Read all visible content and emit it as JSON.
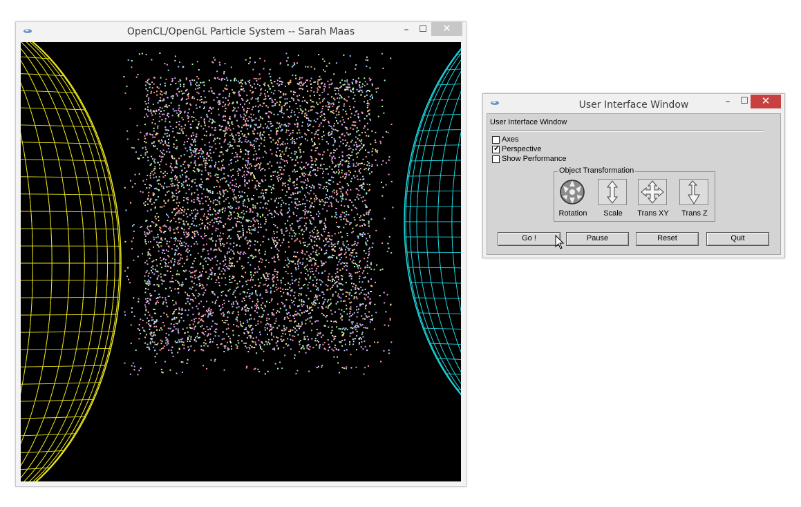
{
  "main_window": {
    "title": "OpenCL/OpenGL Particle System -- Sarah Maas",
    "minimize_glyph": "–",
    "maximize_glyph": "☐",
    "close_glyph": "✕"
  },
  "ui_window": {
    "title": "User Interface Window",
    "minimize_glyph": "–",
    "maximize_glyph": "☐",
    "close_glyph": "✕",
    "panel_title": "User Interface Window",
    "checkboxes": [
      {
        "label": "Axes",
        "checked": false
      },
      {
        "label": "Perspective",
        "checked": true
      },
      {
        "label": "Show Performance",
        "checked": false
      }
    ],
    "check_glyph": "✓",
    "transform_group": {
      "legend": "Object Transformation",
      "tools": [
        {
          "label": "Rotation",
          "icon": "rotation-ball-icon"
        },
        {
          "label": "Scale",
          "icon": "scale-arrows-icon"
        },
        {
          "label": "Trans XY",
          "icon": "translate-xy-icon"
        },
        {
          "label": "Trans Z",
          "icon": "translate-z-icon"
        }
      ]
    },
    "buttons": {
      "go": "Go !",
      "pause": "Pause",
      "reset": "Reset",
      "quit": "Quit"
    }
  },
  "colors": {
    "left_sphere": "#e8e21c",
    "right_sphere": "#1fd0d8",
    "canvas_bg": "#000000",
    "close_active": "#c74140"
  },
  "icons": [
    "app-logo-icon",
    "mouse-cursor-icon"
  ]
}
